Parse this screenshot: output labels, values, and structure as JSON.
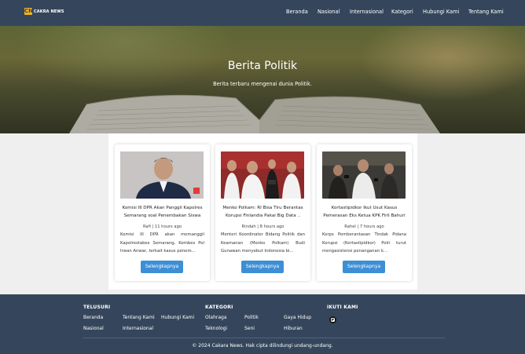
{
  "brand": {
    "logo_mark": "CN",
    "name": "CAKRA NEWS"
  },
  "nav": [
    "Beranda",
    "Nasional",
    "Internasional",
    "Kategori",
    "Hubungi Kami",
    "Tentang Kami"
  ],
  "hero": {
    "title": "Berita Politik",
    "subtitle": "Berita terbaru mengenai dunia Politik."
  },
  "articles": [
    {
      "title": "Komisi III DPR Akan Panggil Kapolres Semarang soal Penembakan Siswa",
      "meta": "Rafi | 11 hours ago",
      "excerpt": "Komisi III DPR akan memanggil Kapolrestabes Semarang, Kombes Pol Irwan Anwar, terkait kasus penem...",
      "button": "Selengkapnya"
    },
    {
      "title": "Menko Polkam: RI Bisa Tiru Berantas Korupsi Finlandia Pakai Big Data ..",
      "meta": "Rindah | 8 hours ago",
      "excerpt": "Menteri Koordinator Bidang Politik dan Keamanan (Menko Polkam) Budi Gunawan menyebut Indonesia bi...",
      "button": "Selengkapnya"
    },
    {
      "title": "Kortastipidkor Ikut Usut Kasus Pemerasan Eks Ketua KPK Firli Bahuri",
      "meta": "Rahel | 7 hours ago",
      "excerpt": "Korps Pemberantasan Tindak Pidana Korupsi (Kortastipidkor) Polri turut mengasistensi penanganan k...",
      "button": "Selengkapnya"
    }
  ],
  "footer": {
    "telusuri": {
      "heading": "TELUSURI",
      "links": [
        "Beranda",
        "Tentang Kami",
        "Hubungi Kami",
        "Nasional",
        "Internasional"
      ]
    },
    "kategori": {
      "heading": "KATEGORI",
      "links": [
        "Olahraga",
        "Politik",
        "Gaya Hidup",
        "Teknologi",
        "Seni",
        "Hiburan"
      ]
    },
    "ikuti": {
      "heading": "IKUTI KAMI",
      "icon": "instagram-icon"
    },
    "copyright": "© 2024 Cakara News. Hak cipta dilindungi undang-undang."
  },
  "colors": {
    "header": "#35465c",
    "button": "#3d8fd5",
    "logo": "#f0b323"
  }
}
